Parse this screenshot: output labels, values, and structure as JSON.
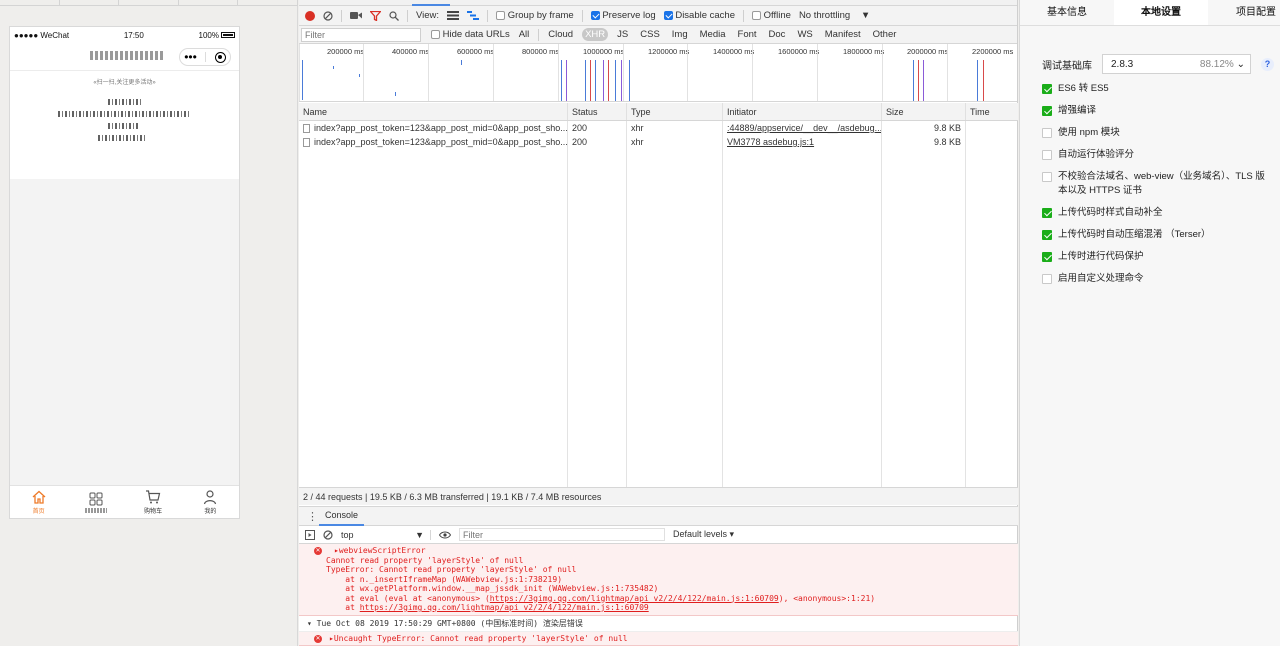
{
  "simulator": {
    "status_bar": {
      "carrier": "●●●●● WeChat",
      "time": "17:50",
      "battery": "100%"
    },
    "scan_tip": "«扫一扫,关注更多活动»",
    "capsule": {
      "more": "•••"
    },
    "tabbar": [
      {
        "label": "首页",
        "icon": "home-icon",
        "active": true
      },
      {
        "label": "",
        "icon": "grid-icon",
        "active": false
      },
      {
        "label": "购物车",
        "icon": "cart-icon",
        "active": false
      },
      {
        "label": "我的",
        "icon": "user-icon",
        "active": false
      }
    ]
  },
  "network": {
    "toolbar": {
      "view_label": "View:",
      "group_by_frame": "Group by frame",
      "preserve_log": "Preserve log",
      "disable_cache": "Disable cache",
      "offline": "Offline",
      "throttling": "No throttling"
    },
    "filter": {
      "placeholder": "Filter",
      "hide_data_urls": "Hide data URLs",
      "types": [
        "All",
        "Cloud",
        "XHR",
        "JS",
        "CSS",
        "Img",
        "Media",
        "Font",
        "Doc",
        "WS",
        "Manifest",
        "Other"
      ],
      "active_type": "XHR"
    },
    "timeline_ticks": [
      "200000 ms",
      "400000 ms",
      "600000 ms",
      "800000 ms",
      "1000000 ms",
      "1200000 ms",
      "1400000 ms",
      "1600000 ms",
      "1800000 ms",
      "2000000 ms",
      "2200000 ms"
    ],
    "columns": {
      "name": "Name",
      "status": "Status",
      "type": "Type",
      "initiator": "Initiator",
      "size": "Size",
      "time": "Time"
    },
    "rows": [
      {
        "name": "index?app_post_token=123&app_post_mid=0&app_post_sho...",
        "status": "200",
        "type": "xhr",
        "initiator": ":44889/appservice/__dev__/asdebug...",
        "size": "9.8 KB",
        "time": ""
      },
      {
        "name": "index?app_post_token=123&app_post_mid=0&app_post_sho...",
        "status": "200",
        "type": "xhr",
        "initiator": "VM3778 asdebug.js:1",
        "size": "9.8 KB",
        "time": ""
      }
    ],
    "summary": "2 / 44 requests | 19.5 KB / 6.3 MB transferred | 19.1 KB / 7.4 MB resources"
  },
  "console": {
    "tab": "Console",
    "context": "top",
    "filter_placeholder": "Filter",
    "levels": "Default levels ▾",
    "error1": {
      "title": "▸webviewScriptError",
      "l1": "Cannot read property 'layerStyle' of null",
      "l2": "TypeError: Cannot read property 'layerStyle' of null",
      "l3": "    at n._insertIframeMap (WAWebview.js:1:738219)",
      "l4": "    at wx.getPlatform.window.__map_jssdk_init (WAWebview.js:1:735482)",
      "l5_pre": "    at eval (eval at <anonymous> (",
      "l5_link": "https://3gimg.qq.com/lightmap/api_v2/2/4/122/main.js:1:60709",
      "l5_post": "), <anonymous>:1:21)",
      "l6_pre": "    at ",
      "l6_link": "https://3gimg.qq.com/lightmap/api_v2/2/4/122/main.js:1:60709"
    },
    "group": "▾ Tue Oct 08 2019 17:50:29 GMT+0800 (中国标准时间) 渲染层错误",
    "error2": "▸Uncaught TypeError: Cannot read property 'layerStyle' of null"
  },
  "details": {
    "tabs": [
      "基本信息",
      "本地设置",
      "项目配置"
    ],
    "active_tab": "本地设置",
    "base_lib_label": "调试基础库",
    "base_lib_version": "2.8.3",
    "base_lib_pct": "88.12%",
    "help": "?",
    "options": [
      {
        "label": "ES6 转 ES5",
        "checked": true
      },
      {
        "label": "增强编译",
        "checked": true
      },
      {
        "label": "使用 npm 模块",
        "checked": false
      },
      {
        "label": "自动运行体验评分",
        "checked": false
      },
      {
        "label": "不校验合法域名、web-view（业务域名）、TLS 版本以及 HTTPS 证书",
        "checked": false
      },
      {
        "label": "上传代码时样式自动补全",
        "checked": true
      },
      {
        "label": "上传代码时自动压缩混淆 （Terser）",
        "checked": true
      },
      {
        "label": "上传时进行代码保护",
        "checked": true
      },
      {
        "label": "启用自定义处理命令",
        "checked": false
      }
    ]
  }
}
